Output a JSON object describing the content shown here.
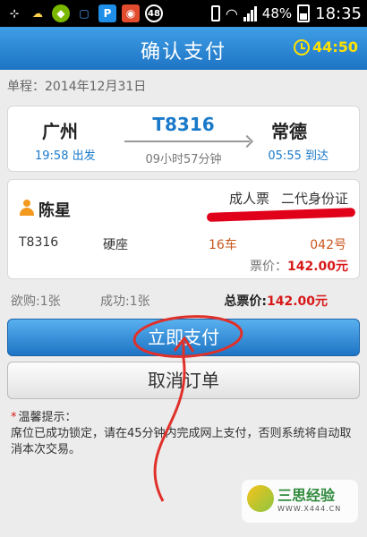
{
  "status_bar": {
    "icons": [
      "usb-icon",
      "weather-icon",
      "app-icon",
      "lock-icon",
      "parking-icon",
      "cat-icon",
      "badge-icon"
    ],
    "badge": "48",
    "battery": "48%",
    "time": "18:35"
  },
  "header": {
    "title": "确认支付",
    "countdown": "44:50",
    "accent": "#1e74c4",
    "countdown_color": "#ffe100"
  },
  "trip": {
    "date_label": "单程：",
    "date": "2014年12月31日",
    "from_station": "广州",
    "to_station": "常德",
    "train_no": "T8316",
    "depart": "19:58 出发",
    "arrive": "05:55 到达",
    "duration": "09小时57分钟"
  },
  "passenger": {
    "name": "陈星",
    "ticket_type": "成人票",
    "id_type": "二代身份证",
    "train": "T8316",
    "seat_class": "硬座",
    "car": "16车",
    "seat_no": "042号",
    "price_label": "票价：",
    "price": "142.00元"
  },
  "summary": {
    "want": "欲购:1张",
    "success": "成功:1张",
    "total_label": "总票价:",
    "total": "142.00元"
  },
  "buttons": {
    "pay": "立即支付",
    "cancel": "取消订单"
  },
  "tips": {
    "star": "*",
    "title": "温馨提示：",
    "body": "席位已成功锁定，请在45分钟内完成网上支付，否则系统将自动取消本次交易。"
  },
  "watermark": {
    "name": "三思经验",
    "url": "WWW.X444.CN"
  }
}
